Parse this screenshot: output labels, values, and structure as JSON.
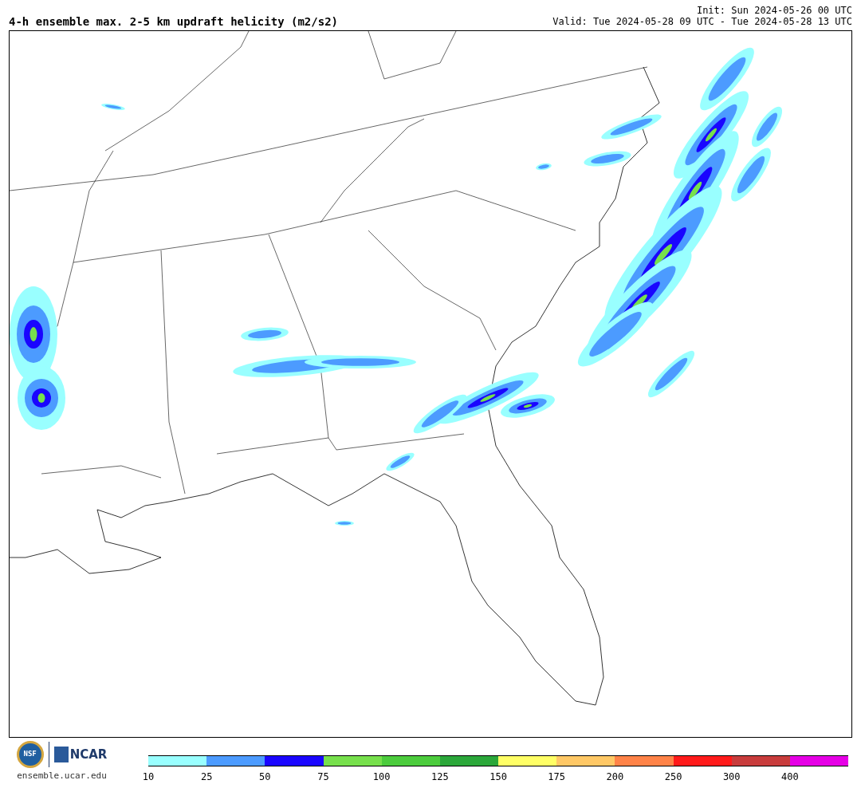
{
  "title": "4-h ensemble max. 2-5 km updraft helicity (m2/s2)",
  "init": "Init: Sun 2024-05-26 00 UTC",
  "valid": "Valid: Tue 2024-05-28 09 UTC - Tue 2024-05-28 13 UTC",
  "footer": {
    "nsf_logo": "NSF",
    "ncar_logo": "NCAR",
    "url": "ensemble.ucar.edu"
  },
  "colorbar": [
    {
      "label": "10",
      "color": "#99ffff"
    },
    {
      "label": "25",
      "color": "#4c9bff"
    },
    {
      "label": "50",
      "color": "#1a05ff"
    },
    {
      "label": "75",
      "color": "#77e04c"
    },
    {
      "label": "100",
      "color": "#4ccc3d"
    },
    {
      "label": "125",
      "color": "#2ba73a"
    },
    {
      "label": "150",
      "color": "#ffff66"
    },
    {
      "label": "175",
      "color": "#ffc866"
    },
    {
      "label": "200",
      "color": "#ff8348"
    },
    {
      "label": "250",
      "color": "#ff1a1a"
    },
    {
      "label": "300",
      "color": "#c83c3c"
    },
    {
      "label": "400",
      "color": "#e600e6"
    }
  ]
}
